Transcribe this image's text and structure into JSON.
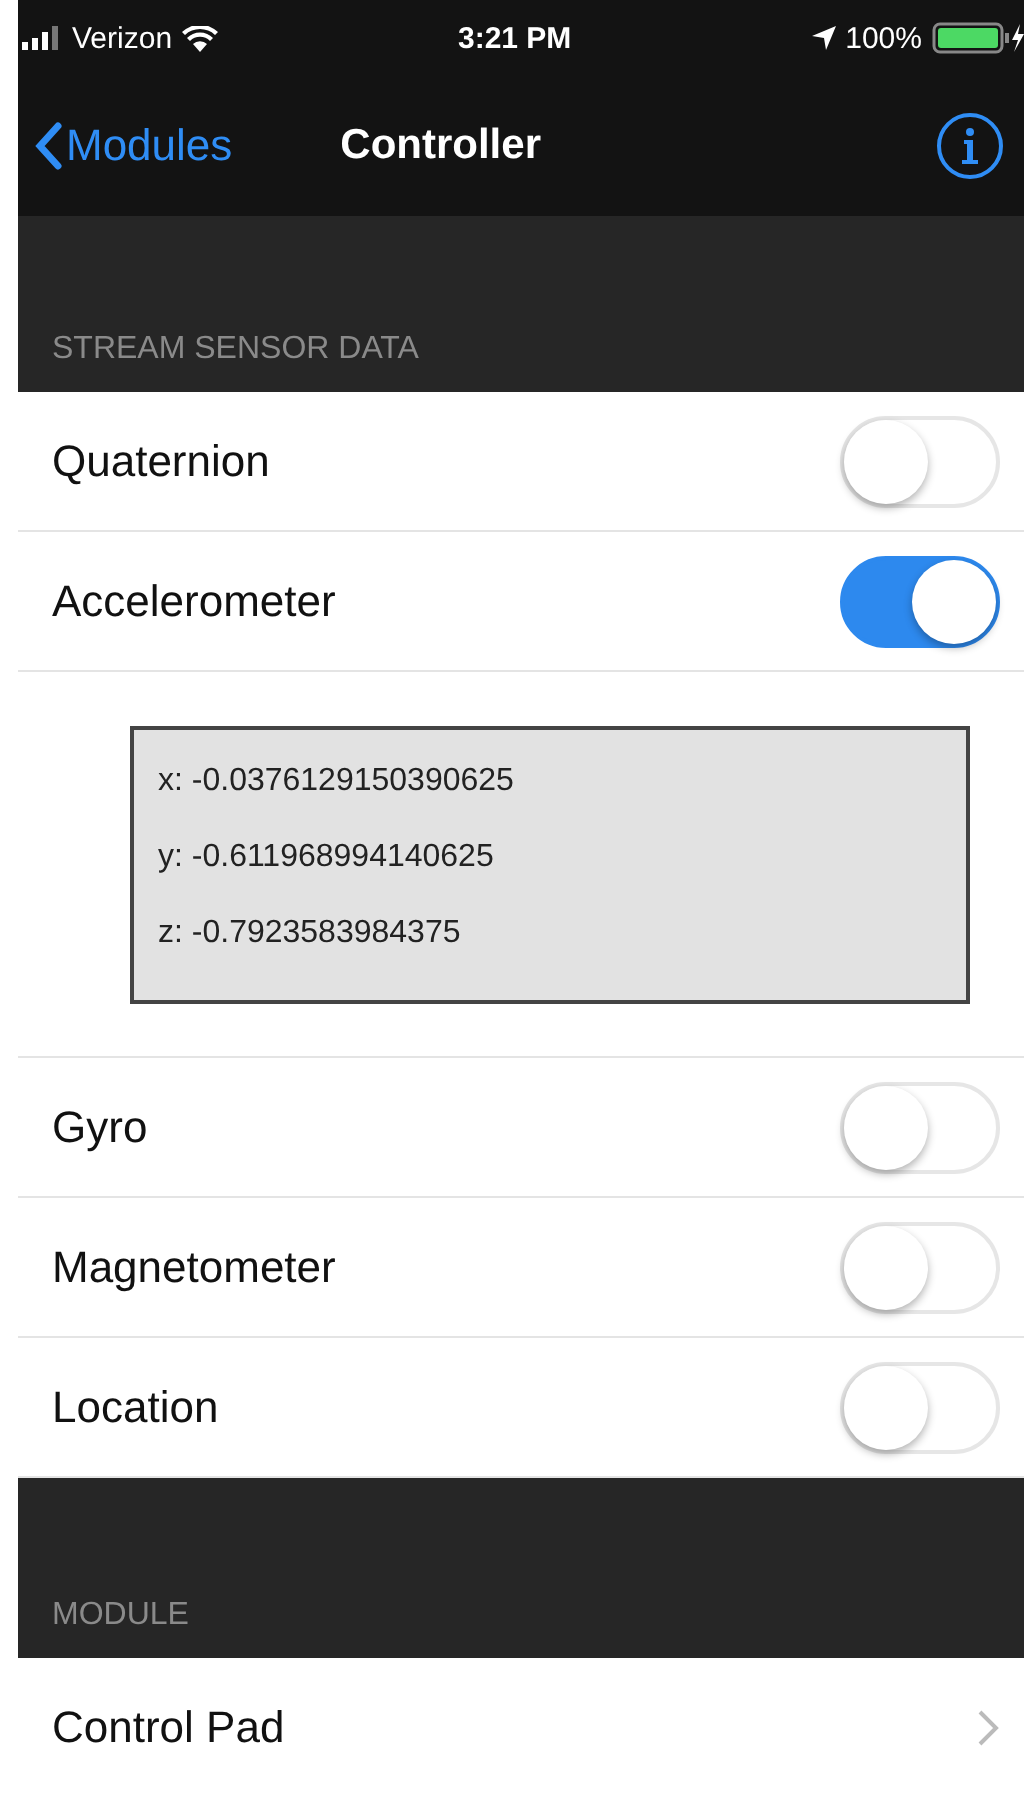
{
  "status_bar": {
    "carrier": "Verizon",
    "time": "3:21 PM",
    "battery": "100%"
  },
  "nav": {
    "back": "Modules",
    "title": "Controller"
  },
  "sections": [
    {
      "header": "STREAM SENSOR DATA",
      "items": [
        {
          "kind": "toggle",
          "label": "Quaternion",
          "on": false
        },
        {
          "kind": "toggle",
          "label": "Accelerometer",
          "on": true
        },
        {
          "kind": "readout",
          "lines": [
            "x: -0.0376129150390625",
            "y: -0.611968994140625",
            "z: -0.7923583984375"
          ]
        },
        {
          "kind": "toggle",
          "label": "Gyro",
          "on": false
        },
        {
          "kind": "toggle",
          "label": "Magnetometer",
          "on": false
        },
        {
          "kind": "toggle",
          "label": "Location",
          "on": false
        }
      ]
    },
    {
      "header": "MODULE",
      "items": [
        {
          "kind": "link",
          "label": "Control Pad"
        }
      ]
    }
  ]
}
